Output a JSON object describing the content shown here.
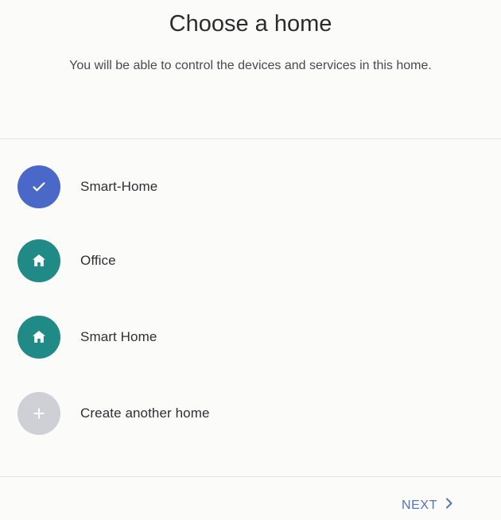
{
  "header": {
    "title": "Choose a home",
    "subtitle": "You will be able to control the devices and services in this home."
  },
  "homes": [
    {
      "label": "Smart-Home",
      "icon": "check-icon",
      "selected": true,
      "color": "#4a68c8"
    },
    {
      "label": "Office",
      "icon": "home-icon",
      "selected": false,
      "color": "#1f8a86"
    },
    {
      "label": "Smart Home",
      "icon": "home-icon",
      "selected": false,
      "color": "#1f8a86"
    },
    {
      "label": "Create another home",
      "icon": "plus-icon",
      "selected": false,
      "color": "#cfd0d6"
    }
  ],
  "footer": {
    "next_label": "NEXT",
    "accent": "#5573b8"
  }
}
